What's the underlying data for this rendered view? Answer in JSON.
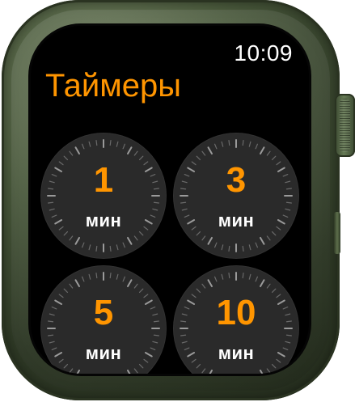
{
  "status": {
    "time": "10:09"
  },
  "app": {
    "title": "Таймеры"
  },
  "timers": [
    {
      "value": "1",
      "unit": "мин"
    },
    {
      "value": "3",
      "unit": "мин"
    },
    {
      "value": "5",
      "unit": "мин"
    },
    {
      "value": "10",
      "unit": "мин"
    }
  ],
  "colors": {
    "accent": "#ff9500",
    "screen": "#000000",
    "tile": "#2a2a2a",
    "text": "#ffffff",
    "case": "#4a5a3c"
  }
}
